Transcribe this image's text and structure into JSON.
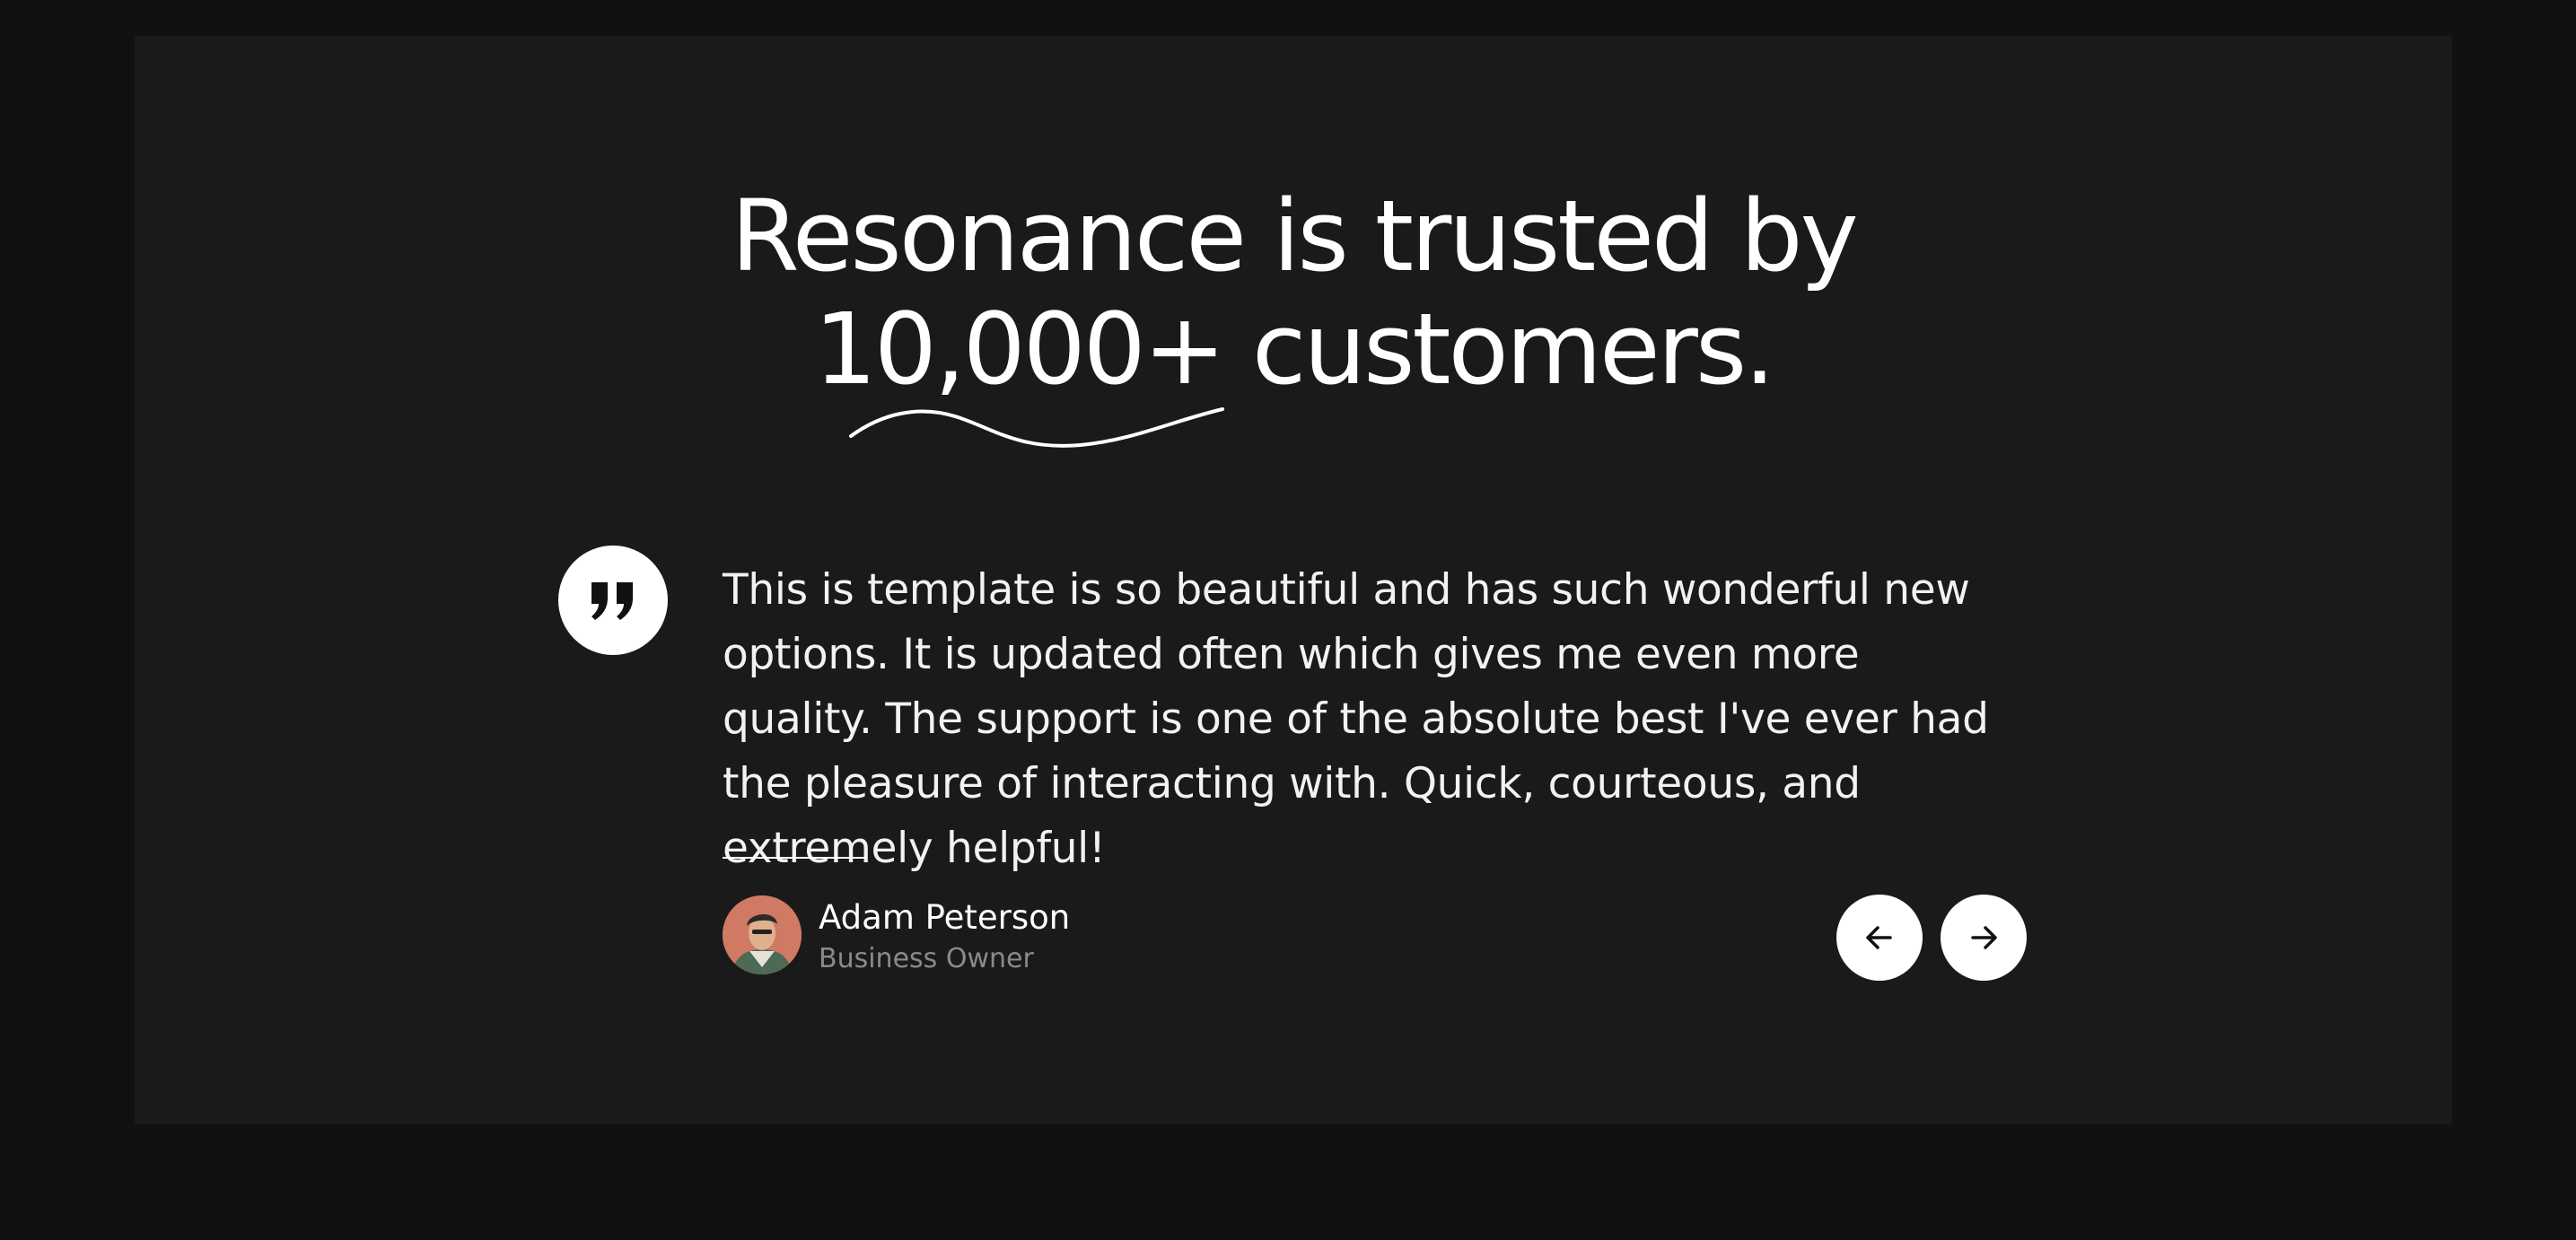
{
  "heading": {
    "line1": "Resonance is trusted by",
    "highlight": "10,000+",
    "line2_rest": " customers."
  },
  "testimonial": {
    "quote": "This is template is so beautiful and has such wonderful new options. It is updated often which gives me even more quality. The support is one of the absolute best I've ever had the pleasure of interacting with. Quick, courteous, and extremely helpful!",
    "author_name": "Adam Peterson",
    "author_role": "Business Owner"
  },
  "icons": {
    "quote": "quote-icon",
    "prev": "arrow-left-icon",
    "next": "arrow-right-icon"
  },
  "colors": {
    "page_background": "#111111",
    "card_background": "#1a1a1a",
    "text": "#ffffff",
    "muted_text": "#8a8a8a",
    "avatar_background": "#d07a63"
  }
}
